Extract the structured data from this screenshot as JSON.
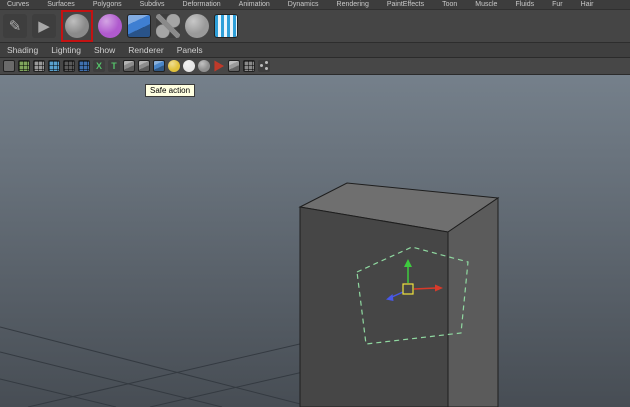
{
  "shelf_tabs": {
    "items": [
      "Curves",
      "Surfaces",
      "Polygons",
      "Subdivs",
      "Deformation",
      "Animation",
      "Dynamics",
      "Rendering",
      "PaintEffects",
      "Toon",
      "Muscle",
      "Fluids",
      "Fur",
      "Hair"
    ]
  },
  "shelf": {
    "icons": [
      {
        "name": "pencil-curve-icon",
        "style": "glyph",
        "glyph": "✎",
        "color": "#b0b0b0"
      },
      {
        "name": "arrow-tool-icon",
        "style": "glyph",
        "glyph": "▶",
        "color": "#a8a8a8"
      },
      {
        "name": "sculpt-sphere-icon",
        "style": "sphere",
        "color": "#8a8a8a",
        "highlighted": true
      },
      {
        "name": "soft-mod-sphere-icon",
        "style": "sphere",
        "color": "#b05ace"
      },
      {
        "name": "lattice-cube-icon",
        "style": "cube",
        "color": "#3f7fd2"
      },
      {
        "name": "wrench-icon",
        "style": "wrench",
        "color": "#999999"
      },
      {
        "name": "round-tool-icon",
        "style": "sphere",
        "color": "#9a9a9a"
      },
      {
        "name": "fluid-stripes-icon",
        "style": "stripes",
        "color": "#2e9fd8"
      }
    ]
  },
  "panel_menu": {
    "items": [
      "Shading",
      "Lighting",
      "Show",
      "Renderer",
      "Panels"
    ]
  },
  "panel_toolbar": {
    "icons": [
      {
        "name": "select-tool-icon",
        "style": "tool",
        "color": "#8a8a8a"
      },
      {
        "name": "grid-display-icon",
        "style": "grid",
        "color": "#7fa45c"
      },
      {
        "name": "film-gate-icon",
        "style": "grid",
        "color": "#9a9a9a"
      },
      {
        "name": "resolution-gate-icon",
        "style": "grid",
        "color": "#58a0cc"
      },
      {
        "name": "gate-mask-icon",
        "style": "grid",
        "color": "#5a5a5a"
      },
      {
        "name": "field-chart-icon",
        "style": "grid",
        "color": "#3e6fae"
      },
      {
        "name": "safe-action-icon",
        "style": "glyph",
        "glyph": "X",
        "color": "#55c26a"
      },
      {
        "name": "safe-title-icon",
        "style": "glyph",
        "glyph": "T",
        "color": "#55c26a"
      },
      {
        "name": "frame-all-icon",
        "style": "cube",
        "color": "#8d8d8d"
      },
      {
        "name": "frame-selection-icon",
        "style": "cube",
        "color": "#8d8d8d"
      },
      {
        "name": "lighting-cube-icon",
        "style": "cube",
        "color": "#4a86c8"
      },
      {
        "name": "default-light-sphere-icon",
        "style": "sphere",
        "color": "#e2c23c"
      },
      {
        "name": "all-lights-sphere-icon",
        "style": "sphere",
        "color": "#e6e6e6"
      },
      {
        "name": "no-lights-sphere-icon",
        "style": "sphere",
        "color": "#909090"
      },
      {
        "name": "isolate-select-icon",
        "style": "pointer",
        "color": "#c03a2a"
      },
      {
        "name": "xray-cube-icon",
        "style": "cube",
        "color": "#9a9a9a"
      },
      {
        "name": "wireframe-shaded-icon",
        "style": "grid",
        "color": "#8a8a8a"
      },
      {
        "name": "share-panel-icon",
        "style": "share",
        "color": "#9a9a9a"
      }
    ]
  },
  "tooltip": {
    "text": "Safe action"
  },
  "highlight_color": "#c41212",
  "viewport": {
    "background_top": "#75808b",
    "background_bottom": "#474d54",
    "grid_color": "#343a41",
    "cube": {
      "top_color": "#6f6f6f",
      "front_color": "#464646",
      "right_color": "#5b5b5b",
      "edge_color": "#1e1e1e"
    },
    "selection_color": "#8fd8a0",
    "manipulator": {
      "x_color": "#d83a2a",
      "y_color": "#3ecb3e",
      "z_color": "#4858e8",
      "center_color": "#efe33c"
    }
  }
}
